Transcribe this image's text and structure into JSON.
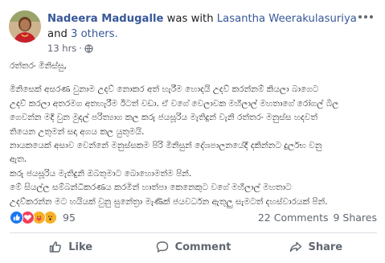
{
  "post": {
    "author": "Nadeera Madugalle",
    "with_text": "was with",
    "tagged": "Lasantha Weerakulasuriya",
    "and_text": "and",
    "others": "3 others.",
    "time": "13 hrs",
    "separator": "·",
    "privacy_icon": "globe-icon",
    "body_lines": [
      "රත්තරං මිනිස්සු,",
      "මිනිසෙක් අසරණ වුනාම උදව් නොකර අත් හැරීම හොදයි උදව් කරන්නම් කියලා බාගෙට",
      "උදව් කරලා අතරමග අතහැරීම ඊටත් වඩා. ඒ වගේ වෙලාවක මහීලාල් මහතාගේ රෝගල් බිල",
      "ගෙවන්න මදි වුන මුදල් පරිත්‍යාග කල කරු ජයසූරිය මැතිදුන් වැනි රත්තරං මනුස්ස හදවත්",
      "තියෙන උතුමන් සදා අගය කල යුතුමයි.",
      "නායකයෙක් අසාව වෙන්නේ මනුස්සකම පිරි මිනිසුන් දේශපාලනයේදී දකින්නට දුර්ලභ වනු",
      "ඇත.",
      "කරු ජයසූරිය මැතිදුනි ඔබතුමාට බොහොමත්ම පින්.",
      "මේ සියල්ල සම්බන්ධීකරණය කරමින් හාත්පා කෙනෙකුට වගේ මහීලාල් මහතාට",
      "උදව්කරන්න මට හයියක් වුනු සුනේත්‍රා මැණික් ජයවර්ධන ඇතුලු සැමටත් දහස්වාරයක් පින්."
    ]
  },
  "reactions": {
    "count": "95",
    "icons": [
      "like-icon",
      "love-icon",
      "care-icon",
      "wow-icon"
    ],
    "comments": "22 Comments",
    "shares": "9 Shares"
  },
  "actions": {
    "like": "Like",
    "comment": "Comment",
    "share": "Share"
  },
  "colors": {
    "link": "#385898",
    "like_blue": "#1877f2",
    "love_red": "#f33e58",
    "care_yellow": "#f7b125",
    "muted": "#606770"
  }
}
